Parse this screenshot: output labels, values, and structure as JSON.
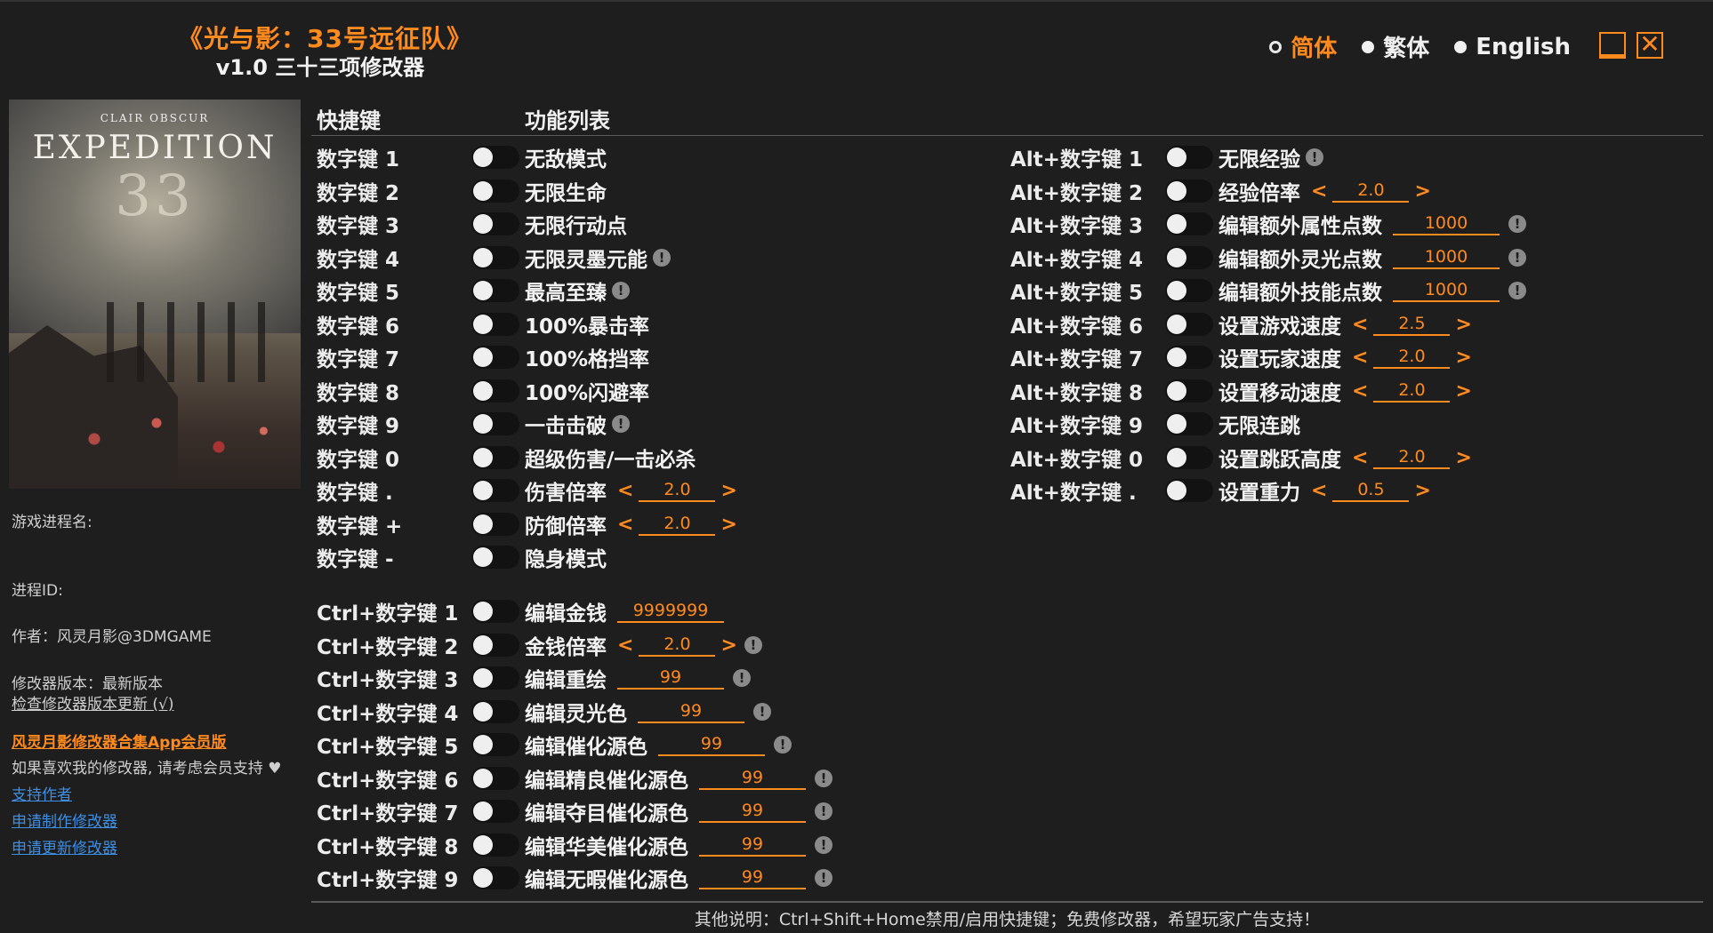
{
  "header": {
    "title": "《光与影：33号远征队》",
    "subtitle": "v1.0 三十三项修改器",
    "languages": [
      {
        "label": "简体",
        "active": true
      },
      {
        "label": "繁体",
        "active": false
      },
      {
        "label": "English",
        "active": false
      }
    ]
  },
  "cover": {
    "small": "CLAIR OBSCUR",
    "big": "EXPEDITION",
    "num": "33"
  },
  "sidebar": {
    "process_name_label": "游戏进程名:",
    "process_id_label": "进程ID:",
    "author": "作者：风灵月影@3DMGAME",
    "version": "修改器版本：最新版本",
    "check_update": "检查修改器版本更新 (√)",
    "vip": "风灵月影修改器合集App会员版",
    "support_text": "如果喜欢我的修改器, 请考虑会员支持",
    "heart": "♥",
    "links": [
      "支持作者",
      "申请制作修改器",
      "申请更新修改器"
    ]
  },
  "columns": {
    "hotkey": "快捷键",
    "features": "功能列表"
  },
  "left_features": [
    {
      "key": "数字键 1",
      "name": "无敌模式"
    },
    {
      "key": "数字键 2",
      "name": "无限生命"
    },
    {
      "key": "数字键 3",
      "name": "无限行动点"
    },
    {
      "key": "数字键 4",
      "name": "无限灵墨元能",
      "info": "!"
    },
    {
      "key": "数字键 5",
      "name": "最高至臻",
      "info": "!"
    },
    {
      "key": "数字键 6",
      "name": "100%暴击率"
    },
    {
      "key": "数字键 7",
      "name": "100%格挡率"
    },
    {
      "key": "数字键 8",
      "name": "100%闪避率"
    },
    {
      "key": "数字键 9",
      "name": "一击击破",
      "info": "!"
    },
    {
      "key": "数字键 0",
      "name": "超级伤害/一击必杀"
    },
    {
      "key": "数字键 .",
      "name": "伤害倍率",
      "value": "2.0"
    },
    {
      "key": "数字键 +",
      "name": "防御倍率",
      "value": "2.0"
    },
    {
      "key": "数字键 -",
      "name": "隐身模式"
    }
  ],
  "ctrl_features": [
    {
      "key": "Ctrl+数字键 1",
      "name": "编辑金钱",
      "field": "9999999"
    },
    {
      "key": "Ctrl+数字键 2",
      "name": "金钱倍率",
      "value": "2.0",
      "info": "!"
    },
    {
      "key": "Ctrl+数字键 3",
      "name": "编辑重绘",
      "field": "99",
      "info": "!"
    },
    {
      "key": "Ctrl+数字键 4",
      "name": "编辑灵光色",
      "field": "99",
      "info": "!"
    },
    {
      "key": "Ctrl+数字键 5",
      "name": "编辑催化源色",
      "field": "99",
      "info": "!"
    },
    {
      "key": "Ctrl+数字键 6",
      "name": "编辑精良催化源色",
      "field": "99",
      "info": "!"
    },
    {
      "key": "Ctrl+数字键 7",
      "name": "编辑夺目催化源色",
      "field": "99",
      "info": "!"
    },
    {
      "key": "Ctrl+数字键 8",
      "name": "编辑华美催化源色",
      "field": "99",
      "info": "!"
    },
    {
      "key": "Ctrl+数字键 9",
      "name": "编辑无暇催化源色",
      "field": "99",
      "info": "!"
    }
  ],
  "alt_features": [
    {
      "key": "Alt+数字键 1",
      "name": "无限经验",
      "info": "!"
    },
    {
      "key": "Alt+数字键 2",
      "name": "经验倍率",
      "value": "2.0"
    },
    {
      "key": "Alt+数字键 3",
      "name": "编辑额外属性点数",
      "field": "1000",
      "info": "!"
    },
    {
      "key": "Alt+数字键 4",
      "name": "编辑额外灵光点数",
      "field": "1000",
      "info": "!"
    },
    {
      "key": "Alt+数字键 5",
      "name": "编辑额外技能点数",
      "field": "1000",
      "info": "!"
    },
    {
      "key": "Alt+数字键 6",
      "name": "设置游戏速度",
      "value": "2.5"
    },
    {
      "key": "Alt+数字键 7",
      "name": "设置玩家速度",
      "value": "2.0"
    },
    {
      "key": "Alt+数字键 8",
      "name": "设置移动速度",
      "value": "2.0"
    },
    {
      "key": "Alt+数字键 9",
      "name": "无限连跳"
    },
    {
      "key": "Alt+数字键 0",
      "name": "设置跳跃高度",
      "value": "2.0"
    },
    {
      "key": "Alt+数字键 .",
      "name": "设置重力",
      "value": "0.5"
    }
  ],
  "arrows": {
    "left": "<",
    "right": ">"
  },
  "footer": "其他说明：Ctrl+Shift+Home禁用/启用快捷键；免费修改器，希望玩家广告支持！",
  "colors": {
    "accent": "#ff8a1e",
    "link": "#3d8fe6",
    "bg": "#1e1e1e"
  }
}
